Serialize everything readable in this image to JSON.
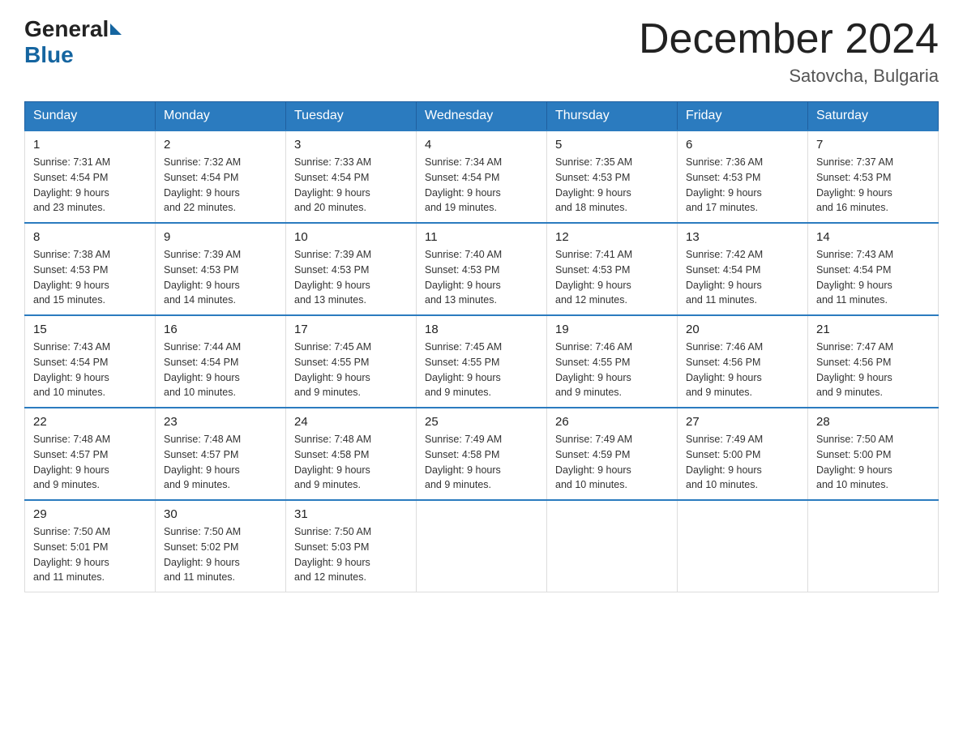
{
  "header": {
    "logo_general": "General",
    "logo_blue": "Blue",
    "month_title": "December 2024",
    "location": "Satovcha, Bulgaria"
  },
  "weekdays": [
    "Sunday",
    "Monday",
    "Tuesday",
    "Wednesday",
    "Thursday",
    "Friday",
    "Saturday"
  ],
  "weeks": [
    [
      {
        "day": "1",
        "sunrise": "7:31 AM",
        "sunset": "4:54 PM",
        "daylight": "9 hours and 23 minutes."
      },
      {
        "day": "2",
        "sunrise": "7:32 AM",
        "sunset": "4:54 PM",
        "daylight": "9 hours and 22 minutes."
      },
      {
        "day": "3",
        "sunrise": "7:33 AM",
        "sunset": "4:54 PM",
        "daylight": "9 hours and 20 minutes."
      },
      {
        "day": "4",
        "sunrise": "7:34 AM",
        "sunset": "4:54 PM",
        "daylight": "9 hours and 19 minutes."
      },
      {
        "day": "5",
        "sunrise": "7:35 AM",
        "sunset": "4:53 PM",
        "daylight": "9 hours and 18 minutes."
      },
      {
        "day": "6",
        "sunrise": "7:36 AM",
        "sunset": "4:53 PM",
        "daylight": "9 hours and 17 minutes."
      },
      {
        "day": "7",
        "sunrise": "7:37 AM",
        "sunset": "4:53 PM",
        "daylight": "9 hours and 16 minutes."
      }
    ],
    [
      {
        "day": "8",
        "sunrise": "7:38 AM",
        "sunset": "4:53 PM",
        "daylight": "9 hours and 15 minutes."
      },
      {
        "day": "9",
        "sunrise": "7:39 AM",
        "sunset": "4:53 PM",
        "daylight": "9 hours and 14 minutes."
      },
      {
        "day": "10",
        "sunrise": "7:39 AM",
        "sunset": "4:53 PM",
        "daylight": "9 hours and 13 minutes."
      },
      {
        "day": "11",
        "sunrise": "7:40 AM",
        "sunset": "4:53 PM",
        "daylight": "9 hours and 13 minutes."
      },
      {
        "day": "12",
        "sunrise": "7:41 AM",
        "sunset": "4:53 PM",
        "daylight": "9 hours and 12 minutes."
      },
      {
        "day": "13",
        "sunrise": "7:42 AM",
        "sunset": "4:54 PM",
        "daylight": "9 hours and 11 minutes."
      },
      {
        "day": "14",
        "sunrise": "7:43 AM",
        "sunset": "4:54 PM",
        "daylight": "9 hours and 11 minutes."
      }
    ],
    [
      {
        "day": "15",
        "sunrise": "7:43 AM",
        "sunset": "4:54 PM",
        "daylight": "9 hours and 10 minutes."
      },
      {
        "day": "16",
        "sunrise": "7:44 AM",
        "sunset": "4:54 PM",
        "daylight": "9 hours and 10 minutes."
      },
      {
        "day": "17",
        "sunrise": "7:45 AM",
        "sunset": "4:55 PM",
        "daylight": "9 hours and 9 minutes."
      },
      {
        "day": "18",
        "sunrise": "7:45 AM",
        "sunset": "4:55 PM",
        "daylight": "9 hours and 9 minutes."
      },
      {
        "day": "19",
        "sunrise": "7:46 AM",
        "sunset": "4:55 PM",
        "daylight": "9 hours and 9 minutes."
      },
      {
        "day": "20",
        "sunrise": "7:46 AM",
        "sunset": "4:56 PM",
        "daylight": "9 hours and 9 minutes."
      },
      {
        "day": "21",
        "sunrise": "7:47 AM",
        "sunset": "4:56 PM",
        "daylight": "9 hours and 9 minutes."
      }
    ],
    [
      {
        "day": "22",
        "sunrise": "7:48 AM",
        "sunset": "4:57 PM",
        "daylight": "9 hours and 9 minutes."
      },
      {
        "day": "23",
        "sunrise": "7:48 AM",
        "sunset": "4:57 PM",
        "daylight": "9 hours and 9 minutes."
      },
      {
        "day": "24",
        "sunrise": "7:48 AM",
        "sunset": "4:58 PM",
        "daylight": "9 hours and 9 minutes."
      },
      {
        "day": "25",
        "sunrise": "7:49 AM",
        "sunset": "4:58 PM",
        "daylight": "9 hours and 9 minutes."
      },
      {
        "day": "26",
        "sunrise": "7:49 AM",
        "sunset": "4:59 PM",
        "daylight": "9 hours and 10 minutes."
      },
      {
        "day": "27",
        "sunrise": "7:49 AM",
        "sunset": "5:00 PM",
        "daylight": "9 hours and 10 minutes."
      },
      {
        "day": "28",
        "sunrise": "7:50 AM",
        "sunset": "5:00 PM",
        "daylight": "9 hours and 10 minutes."
      }
    ],
    [
      {
        "day": "29",
        "sunrise": "7:50 AM",
        "sunset": "5:01 PM",
        "daylight": "9 hours and 11 minutes."
      },
      {
        "day": "30",
        "sunrise": "7:50 AM",
        "sunset": "5:02 PM",
        "daylight": "9 hours and 11 minutes."
      },
      {
        "day": "31",
        "sunrise": "7:50 AM",
        "sunset": "5:03 PM",
        "daylight": "9 hours and 12 minutes."
      },
      null,
      null,
      null,
      null
    ]
  ]
}
